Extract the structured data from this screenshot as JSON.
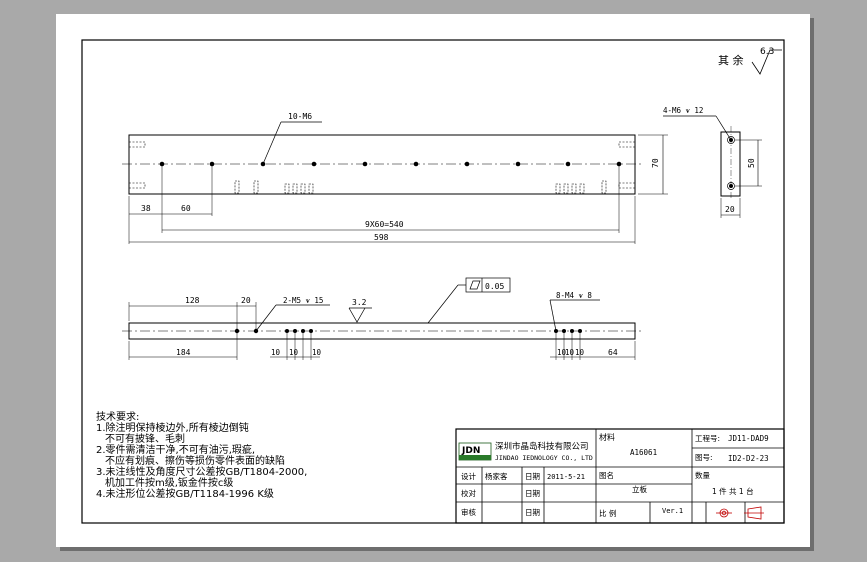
{
  "roughness": {
    "other_label": "其 余",
    "value": "6.3"
  },
  "top_view": {
    "callout_holes": "10-M6",
    "dim_left_edge": "38",
    "dim_first_pitch": "60",
    "dim_pitch_total": "9X60=540",
    "dim_overall_length": "598",
    "dim_height": "70"
  },
  "end_view": {
    "callout_holes": "4-M6 ⩛ 12",
    "dim_hole_spacing": "50",
    "dim_width": "20"
  },
  "front_view": {
    "dim_left_offset": "128",
    "dim_spacing_20": "20",
    "callout_left": "2-M5 ⩛ 15",
    "roughness_value": "3.2",
    "flatness_value": "0.05",
    "callout_right": "8-M4 ⩛ 8",
    "dim_184": "184",
    "dim_left_10s": [
      "10",
      "10",
      "10"
    ],
    "dim_right_10s": [
      "10",
      "10",
      "10"
    ],
    "dim_64": "64"
  },
  "tech_notes": {
    "title": "技术要求:",
    "lines": [
      "1.除注明保持棱边外,所有棱边倒钝",
      "不可有披锋、毛刺",
      "2.零件需清洁干净,不可有油污,瑕疵,",
      "不应有划痕、擦伤等损伤零件表面的缺陷",
      "3.未注线性及角度尺寸公差按GB/T1804-2000,",
      "机加工件按m级,钣金件按c级",
      "4.未注形位公差按GB/T1184-1996 K级"
    ]
  },
  "title_block": {
    "logo_text": "JDN",
    "company_cn": "深圳市晶岛科技有限公司",
    "company_en": "JINDAO IEDNOLOGY CO., LTD",
    "material_label": "材料",
    "material_value": "A16061",
    "project_label": "工程号:",
    "project_value": "JD11-DAD9",
    "drawing_no_label": "图号:",
    "drawing_no_value": "ID2-D2-23",
    "design_label": "设计",
    "designer": "杨家客",
    "date_label": "日期",
    "date_value": "2011-5-21",
    "name_label": "图名",
    "name_value": "立板",
    "quantity_label": "数量",
    "quantity_value": "1 件   共 1 台",
    "check_label": "校对",
    "check_date_label": "日期",
    "approve_label": "审核",
    "approve_date_label": "日期",
    "scale_label": "比 例",
    "version_label": "Ver.1"
  }
}
